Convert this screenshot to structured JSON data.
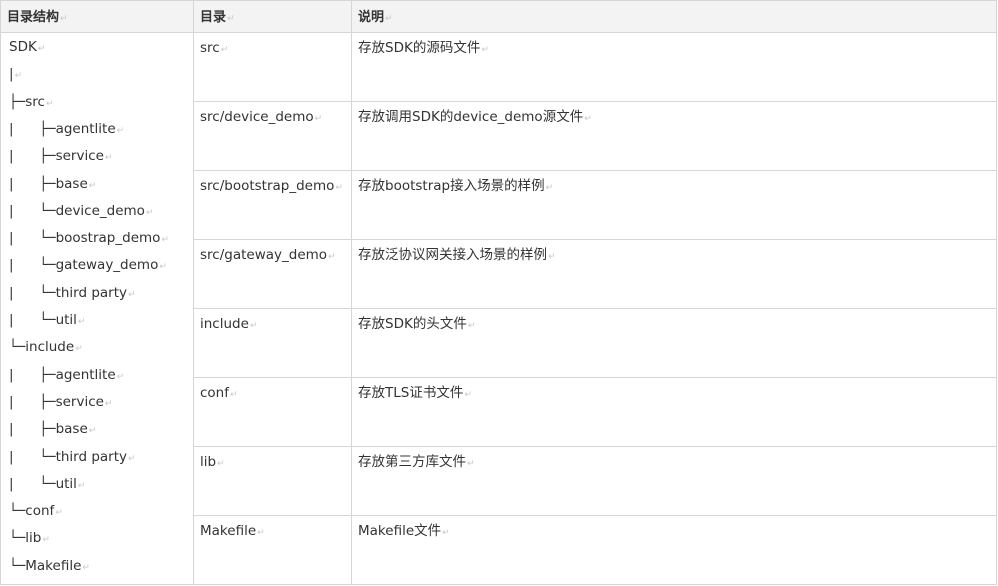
{
  "header": {
    "col1": "目录结构",
    "col2": "目录",
    "col3": "说明"
  },
  "paragraph_mark": "↵",
  "tree": [
    {
      "indent": "",
      "connector": "",
      "name": "SDK"
    },
    {
      "indent": "  ",
      "connector": "|",
      "name": ""
    },
    {
      "indent": "",
      "connector": "├─",
      "name": "src"
    },
    {
      "indent": "",
      "connector": "|      ├─",
      "name": "agentlite"
    },
    {
      "indent": "",
      "connector": "|      ├─",
      "name": "service"
    },
    {
      "indent": "",
      "connector": "|      ├─",
      "name": "base"
    },
    {
      "indent": "",
      "connector": "|      └─",
      "name": "device_demo"
    },
    {
      "indent": "",
      "connector": "|      └─",
      "name": "boostrap_demo"
    },
    {
      "indent": "",
      "connector": "|      └─",
      "name": "gateway_demo"
    },
    {
      "indent": "",
      "connector": "|      └─",
      "name": "third party"
    },
    {
      "indent": "",
      "connector": "|      └─",
      "name": "util"
    },
    {
      "indent": "",
      "connector": "└─",
      "name": "include"
    },
    {
      "indent": "",
      "connector": "|      ├─",
      "name": "agentlite"
    },
    {
      "indent": "",
      "connector": "|      ├─",
      "name": "service"
    },
    {
      "indent": "",
      "connector": "|      ├─",
      "name": "base"
    },
    {
      "indent": "",
      "connector": "|      └─",
      "name": "third party"
    },
    {
      "indent": "",
      "connector": "|      └─",
      "name": "util"
    },
    {
      "indent": "",
      "connector": "└─",
      "name": "conf"
    },
    {
      "indent": "",
      "connector": "└─",
      "name": "lib"
    },
    {
      "indent": "",
      "connector": "└─",
      "name": "Makefile"
    }
  ],
  "rows": [
    {
      "dir": "src",
      "desc": "存放SDK的源码文件"
    },
    {
      "dir": "src/device_demo",
      "desc": "存放调用SDK的device_demo源文件"
    },
    {
      "dir": "src/bootstrap_demo",
      "desc": "存放bootstrap接入场景的样例"
    },
    {
      "dir": "src/gateway_demo",
      "desc": "存放泛协议网关接入场景的样例"
    },
    {
      "dir": "include",
      "desc": "存放SDK的头文件"
    },
    {
      "dir": "conf",
      "desc": "存放TLS证书文件"
    },
    {
      "dir": "lib",
      "desc": "存放第三方库文件"
    },
    {
      "dir": "Makefile",
      "desc": "Makefile文件"
    }
  ]
}
